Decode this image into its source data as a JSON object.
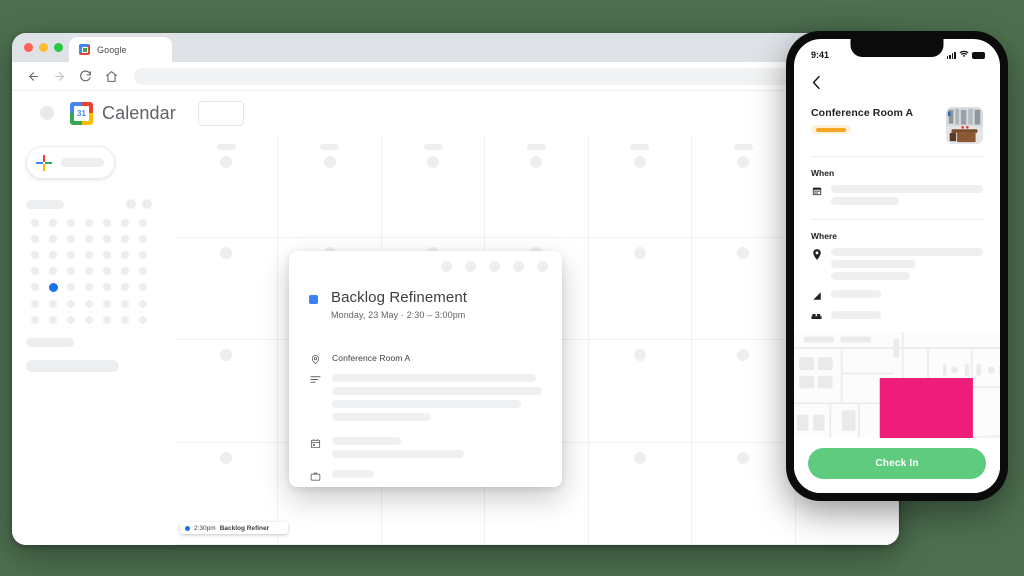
{
  "background_color": "#4e7050",
  "browser": {
    "tab": {
      "title": "Google",
      "favicon": "google-favicon"
    },
    "traffic_lights": [
      "close",
      "minimize",
      "maximize"
    ],
    "toolbar": {
      "back_icon": "arrow-left-icon",
      "forward_icon": "arrow-right-icon",
      "reload_icon": "reload-icon",
      "home_icon": "home-icon",
      "address_placeholder": ""
    }
  },
  "calendar_app": {
    "header": {
      "menu_icon": "hamburger-menu-icon",
      "logo": "google-calendar-logo",
      "logo_day": "31",
      "title": "Calendar",
      "left_button_label": "",
      "right_button_label": ""
    },
    "sidebar": {
      "create_button_label": "",
      "create_icon": "google-plus-icon",
      "mini_calendar": {
        "month_label": "",
        "prev_icon": "chevron-left-icon",
        "next_icon": "chevron-right-icon",
        "today_index": 29,
        "cell_count": 49
      }
    },
    "grid": {
      "columns": 7,
      "rows": 4,
      "event_chip": {
        "time": "2:30pm",
        "title": "Backlog Refiner",
        "color": "#1a73e8"
      }
    }
  },
  "event_popup": {
    "action_icons": [
      "room-icon",
      "mail-icon",
      "more-icon",
      "help-icon",
      "close-icon"
    ],
    "color_swatch": "#3b7ff0",
    "title": "Backlog Refinement",
    "subtitle": "Monday, 23 May  ·  2:30 – 3:00pm",
    "rows": [
      {
        "icon": "location-pin-icon",
        "text": "Conference Room A"
      },
      {
        "icon": "description-icon",
        "text": ""
      },
      {
        "icon": "calendar-icon",
        "text": ""
      },
      {
        "icon": "briefcase-icon",
        "text": ""
      }
    ]
  },
  "phone": {
    "status_bar": {
      "time": "9:41",
      "signal_icon": "cellular-signal-icon",
      "wifi_icon": "wifi-icon",
      "battery_icon": "battery-icon"
    },
    "back_icon": "chevron-left-icon",
    "room": {
      "name": "Conference Room A",
      "badge_label": "",
      "badge_color": "#f5a623",
      "thumbnail": "conference-room-photo"
    },
    "sections": [
      {
        "label": "When",
        "rows": [
          {
            "icon": "calendar-icon",
            "lines": 2
          }
        ]
      },
      {
        "label": "Where",
        "rows": [
          {
            "icon": "location-pin-icon",
            "lines": 3
          },
          {
            "icon": "floor-level-icon",
            "lines": 1
          },
          {
            "icon": "seats-icon",
            "lines": 1
          }
        ]
      }
    ],
    "map": {
      "type": "floor-plan",
      "highlight_color": "#ee1d7a",
      "highlight_label": ""
    },
    "cta_label": "Check In",
    "cta_color": "#5ecb7e"
  }
}
